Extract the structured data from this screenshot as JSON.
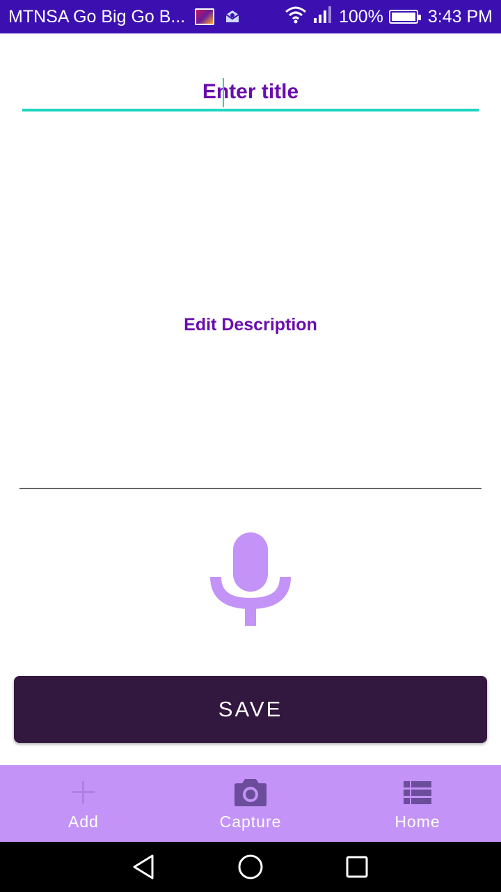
{
  "status_bar": {
    "carrier": "MTNSA Go Big Go B...",
    "battery": "100%",
    "time": "3:43 PM"
  },
  "form": {
    "title_placeholder": "Enter title",
    "title_value": "",
    "description_placeholder": "Edit Description",
    "description_value": ""
  },
  "actions": {
    "save_label": "SAVE"
  },
  "bottom_nav": {
    "items": [
      {
        "label": "Add",
        "icon": "plus-icon"
      },
      {
        "label": "Capture",
        "icon": "camera-icon"
      },
      {
        "label": "Home",
        "icon": "list-icon"
      }
    ]
  },
  "colors": {
    "status_bar": "#3c10b0",
    "accent_text": "#6a0dad",
    "title_underline": "#1ed6c0",
    "mic": "#c393f7",
    "save_button": "#32173f",
    "bottom_nav": "#c393f7"
  }
}
